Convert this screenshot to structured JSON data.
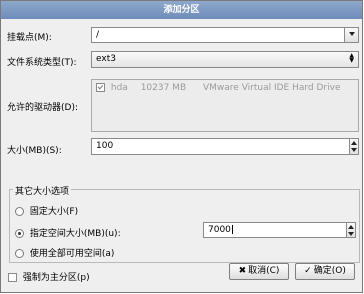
{
  "window": {
    "title": "添加分区"
  },
  "mount_point": {
    "label": "挂载点(M):",
    "value": "/"
  },
  "fs_type": {
    "label": "文件系统类型(T):",
    "value": "ext3"
  },
  "drives": {
    "label": "允许的驱动器(D):",
    "items": [
      {
        "checked": true,
        "name": "hda",
        "size": "10237 MB",
        "model": "VMware Virtual IDE Hard Drive"
      }
    ]
  },
  "size": {
    "label": "大小(MB)(S):",
    "value": "100"
  },
  "other_size": {
    "title": "其它大小选项",
    "options": [
      {
        "label": "固定大小(F)",
        "selected": false
      },
      {
        "label": "指定空间大小(MB)(u):",
        "selected": true,
        "value": "7000"
      },
      {
        "label": "使用全部可用空间(a)",
        "selected": false
      }
    ]
  },
  "primary": {
    "label": "强制为主分区(p)",
    "checked": false
  },
  "buttons": {
    "cancel": "取消(C)",
    "ok": "确定(O)"
  }
}
